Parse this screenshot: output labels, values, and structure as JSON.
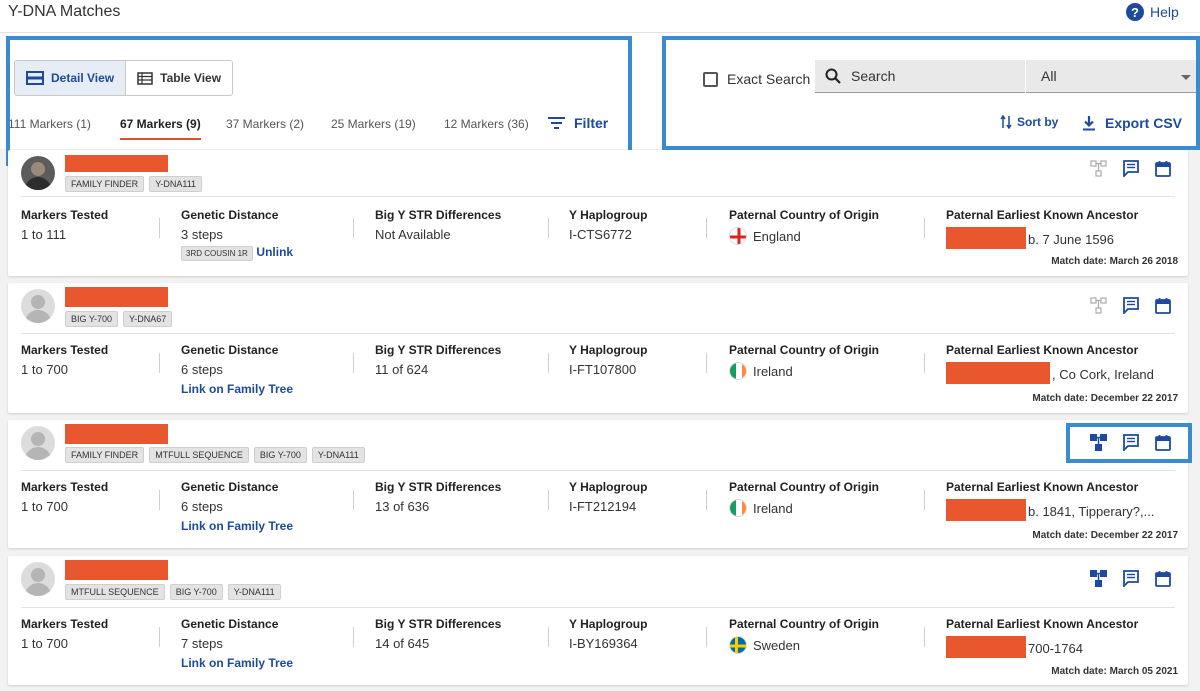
{
  "header": {
    "title": "Y-DNA Matches",
    "help_label": "Help",
    "help_icon": "question-circle-icon"
  },
  "views": {
    "detail_label": "Detail View",
    "table_label": "Table View",
    "active": "detail"
  },
  "marker_tabs": [
    {
      "label": "111 Markers (1)",
      "active": false
    },
    {
      "label": "67 Markers (9)",
      "active": true
    },
    {
      "label": "37 Markers (2)",
      "active": false
    },
    {
      "label": "25 Markers (19)",
      "active": false
    },
    {
      "label": "12 Markers (36)",
      "active": false
    }
  ],
  "filter_label": "Filter",
  "exact_search_label": "Exact Search",
  "search": {
    "placeholder": "Search",
    "value": ""
  },
  "select": {
    "selected": "All"
  },
  "sort_label": "Sort by",
  "export_label": "Export CSV",
  "columns": {
    "markers": "Markers Tested",
    "distance": "Genetic Distance",
    "bigy": "Big Y STR Differences",
    "haplo": "Y Haplogroup",
    "country": "Paternal Country of Origin",
    "ancestor": "Paternal Earliest Known Ancestor"
  },
  "colors": {
    "accent": "#1d4a9c",
    "redaction": "#e8572d",
    "highlight": "#3b8bd0"
  },
  "matches": [
    {
      "tags": [
        "FAMILY FINDER",
        "Y-DNA111"
      ],
      "markers": "1 to 111",
      "distance": "3 steps",
      "relationship": "3RD COUSIN 1R",
      "action": "Unlink",
      "bigy": "Not Available",
      "haplo": "I-CTS6772",
      "country": "England",
      "ancestor": "b. 7 June 1596",
      "match_date": "Match date: March 26 2018"
    },
    {
      "tags": [
        "BIG Y-700",
        "Y-DNA67"
      ],
      "markers": "1 to 700",
      "distance": "6 steps",
      "action": "Link on Family Tree",
      "bigy": "11 of 624",
      "haplo": "I-FT107800",
      "country": "Ireland",
      "ancestor": ", Co Cork, Ireland",
      "match_date": "Match date: December 22 2017"
    },
    {
      "tags": [
        "FAMILY FINDER",
        "MTFULL SEQUENCE",
        "BIG Y-700",
        "Y-DNA111"
      ],
      "markers": "1 to 700",
      "distance": "6 steps",
      "action": "Link on Family Tree",
      "bigy": "13 of 636",
      "haplo": "I-FT212194",
      "country": "Ireland",
      "ancestor": "b. 1841, Tipperary?,...",
      "match_date": "Match date: December 22 2017"
    },
    {
      "tags": [
        "MTFULL SEQUENCE",
        "BIG Y-700",
        "Y-DNA111"
      ],
      "markers": "1 to 700",
      "distance": "7 steps",
      "action": "Link on Family Tree",
      "bigy": "14 of 645",
      "haplo": "I-BY169364",
      "country": "Sweden",
      "ancestor": "700-1764",
      "match_date": "Match date: March 05 2021"
    }
  ]
}
